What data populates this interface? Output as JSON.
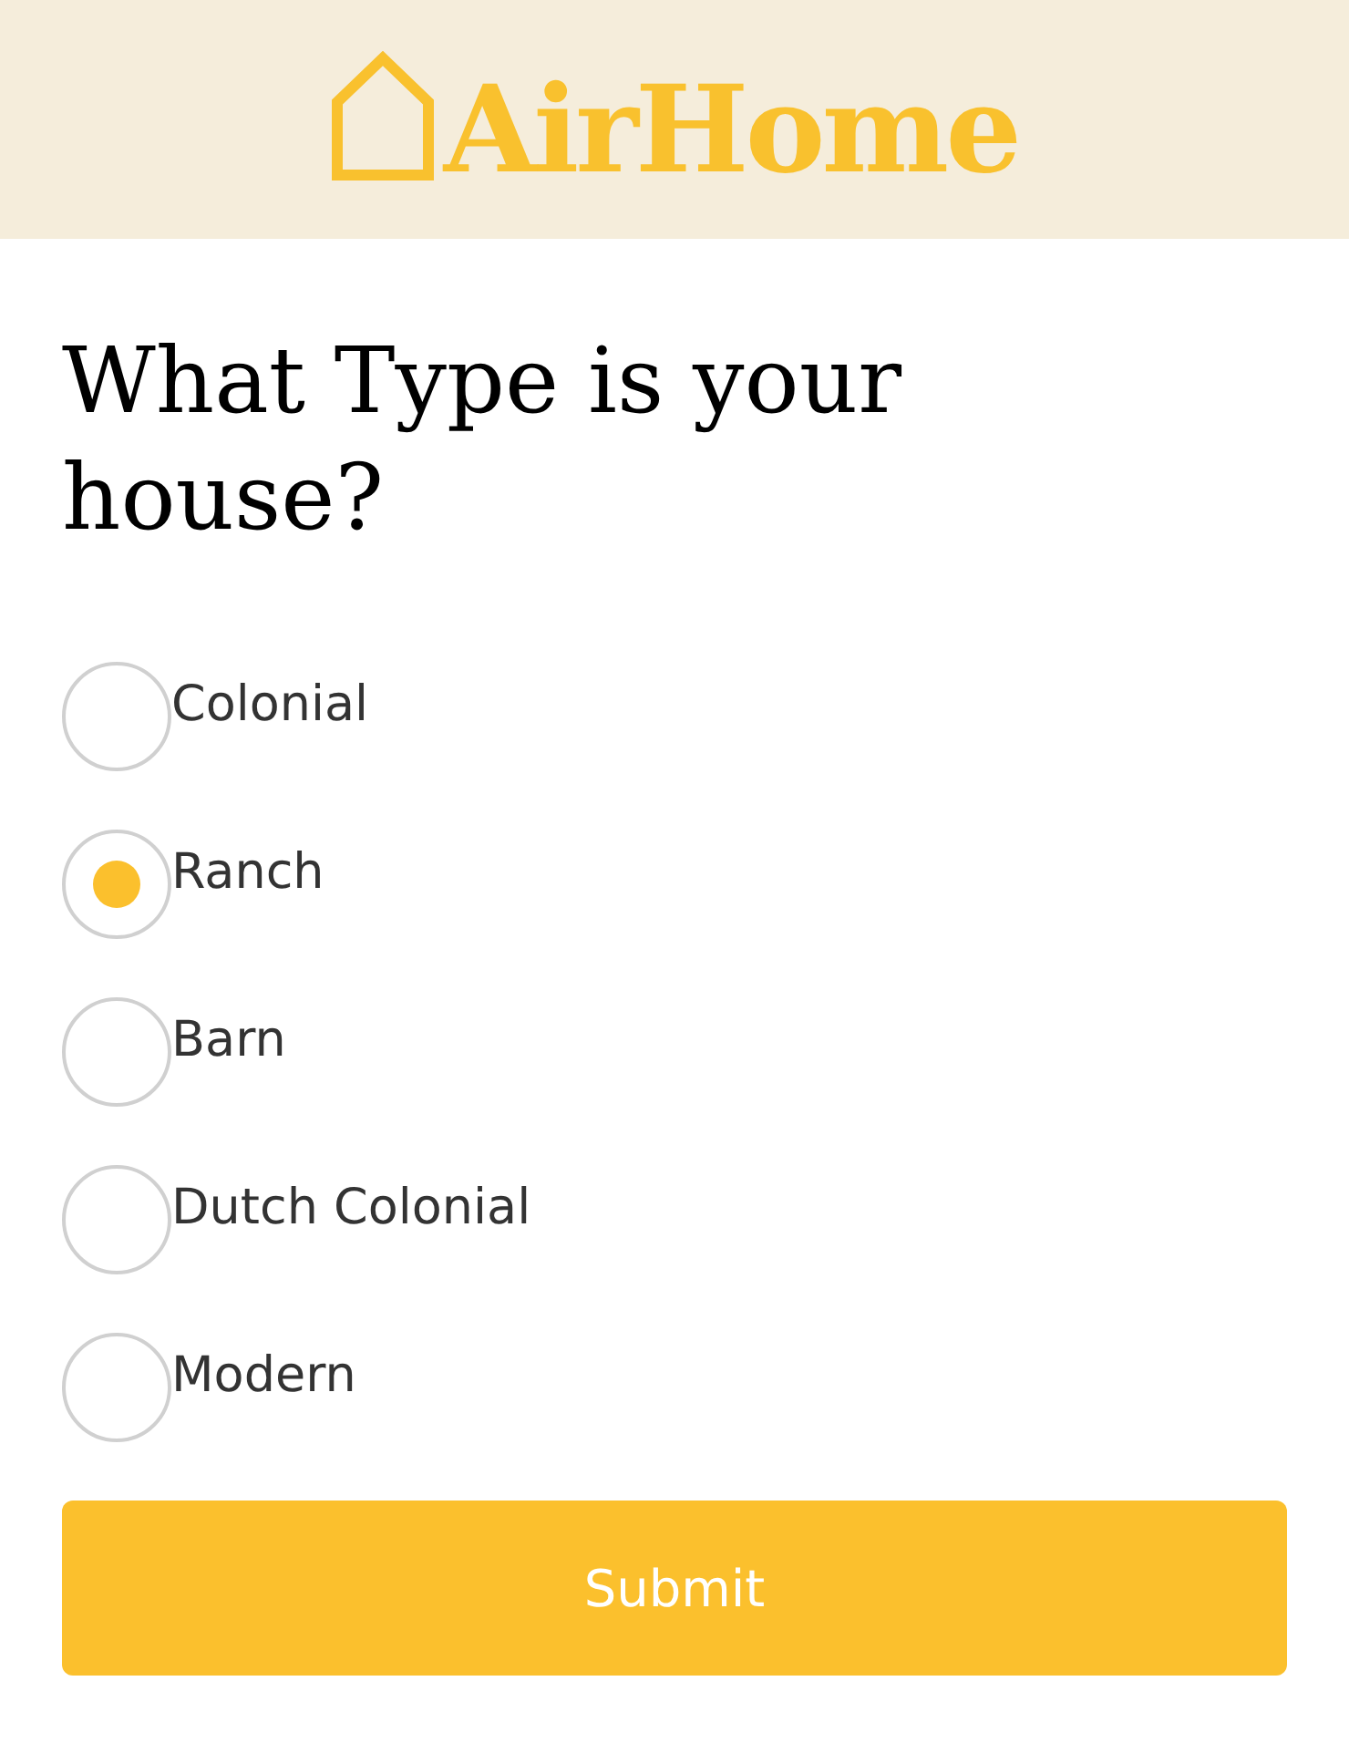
{
  "header": {
    "logo_text": "AirHome"
  },
  "question": "What Type is your house?",
  "options": [
    {
      "label": "Colonial",
      "selected": false
    },
    {
      "label": "Ranch",
      "selected": true
    },
    {
      "label": "Barn",
      "selected": false
    },
    {
      "label": "Dutch Colonial",
      "selected": false
    },
    {
      "label": "Modern",
      "selected": false
    }
  ],
  "submit": "Submit"
}
